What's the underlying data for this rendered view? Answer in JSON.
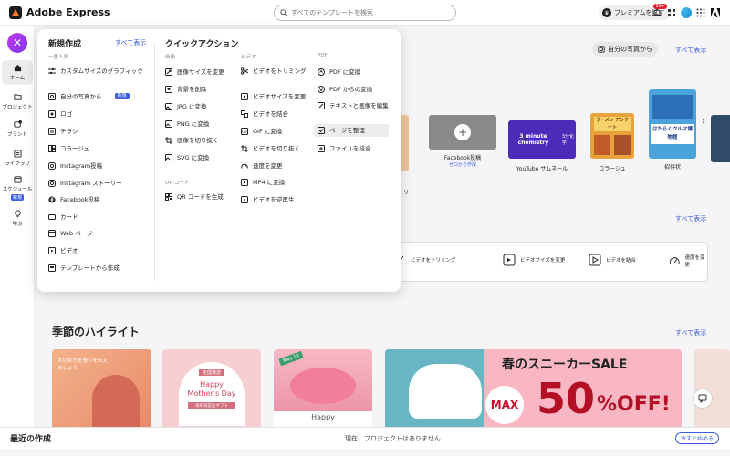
{
  "header": {
    "app_name": "Adobe Express",
    "search_placeholder": "すべてのテンプレートを検索",
    "premium_label": "プレミアムを試す",
    "notification_count": "99+"
  },
  "rail": {
    "items": [
      {
        "label": "ホーム"
      },
      {
        "label": "プロジェクト"
      },
      {
        "label": "ブランド"
      },
      {
        "label": "ライブラリ"
      },
      {
        "label": "スケジュール",
        "badge": "新規"
      },
      {
        "label": "学ぶ"
      }
    ]
  },
  "main": {
    "photo_button": "自分の写真から",
    "see_all": "すべて表示",
    "carousel": [
      {
        "caption": "ーリ"
      },
      {
        "caption": "Facebook投稿",
        "sub": "ゼロから作成"
      },
      {
        "caption": "YouTube サムネール"
      },
      {
        "caption": "コラージュ"
      },
      {
        "caption": "招待状"
      }
    ],
    "thumb_texts": {
      "chemistry": "3 minute chemistry",
      "chemistry_side": "3分化学",
      "ramen": "ラーメン アンケート",
      "kids": "はたらくクルマ博物館"
    },
    "quick_actions": [
      {
        "label": "ビデオをトリミング"
      },
      {
        "label": "ビデオサイズを変更"
      },
      {
        "label": "ビデオを結合"
      },
      {
        "label": "速度を変更"
      }
    ],
    "seasonal_title": "季節のハイライト",
    "banner_texts": {
      "card1": "大切な方を想いを伝えましょう",
      "card2_top": "全国発送",
      "card2_title": "Happy Mother's Day",
      "card2_sub": "母の日記念ギフト",
      "card3_tag": "May 10",
      "card3_bottom": "Happy",
      "sale_title": "春のスニーカーSALE",
      "sale_max": "MAX",
      "sale_value": "50",
      "sale_off": "%OFF!"
    }
  },
  "footer": {
    "title": "最近の作成",
    "message": "現在、プロジェクトはありません",
    "start_button": "今すぐ始める"
  },
  "menu": {
    "create_title": "新規作成",
    "see_all": "すべて表示",
    "popular_label": "一番人気",
    "create_items": [
      {
        "label": "カスタムサイズのグラフィック"
      },
      {
        "label": "自分の写真から",
        "badge": "新規"
      },
      {
        "label": "ロゴ"
      },
      {
        "label": "チラシ"
      },
      {
        "label": "コラージュ"
      },
      {
        "label": "Instagram投稿"
      },
      {
        "label": "Instagram ストーリー"
      },
      {
        "label": "Facebook投稿"
      },
      {
        "label": "カード"
      },
      {
        "label": "Web ページ"
      },
      {
        "label": "ビデオ"
      },
      {
        "label": "テンプレートから作成"
      }
    ],
    "quick_title": "クイックアクション",
    "image_label": "画像",
    "image_items": [
      {
        "label": "画像サイズを変更"
      },
      {
        "label": "背景を削除"
      },
      {
        "label": "JPG に変換"
      },
      {
        "label": "PNG に変換"
      },
      {
        "label": "画像を切り抜く"
      },
      {
        "label": "SVG に変換"
      }
    ],
    "qr_label": "QR コード",
    "qr_items": [
      {
        "label": "QR コードを生成"
      }
    ],
    "video_label": "ビデオ",
    "video_items": [
      {
        "label": "ビデオをトリミング"
      },
      {
        "label": "ビデオサイズを変更"
      },
      {
        "label": "ビデオを結合"
      },
      {
        "label": "GIF に変換"
      },
      {
        "label": "ビデオを切り抜く"
      },
      {
        "label": "速度を変更"
      },
      {
        "label": "MP4 に変換"
      },
      {
        "label": "ビデオを逆再生"
      }
    ],
    "pdf_label": "PDF",
    "pdf_items": [
      {
        "label": "PDF に変換"
      },
      {
        "label": "PDF からの変換"
      },
      {
        "label": "テキストと画像を編集"
      },
      {
        "label": "ページを整理"
      },
      {
        "label": "ファイルを結合"
      }
    ]
  }
}
